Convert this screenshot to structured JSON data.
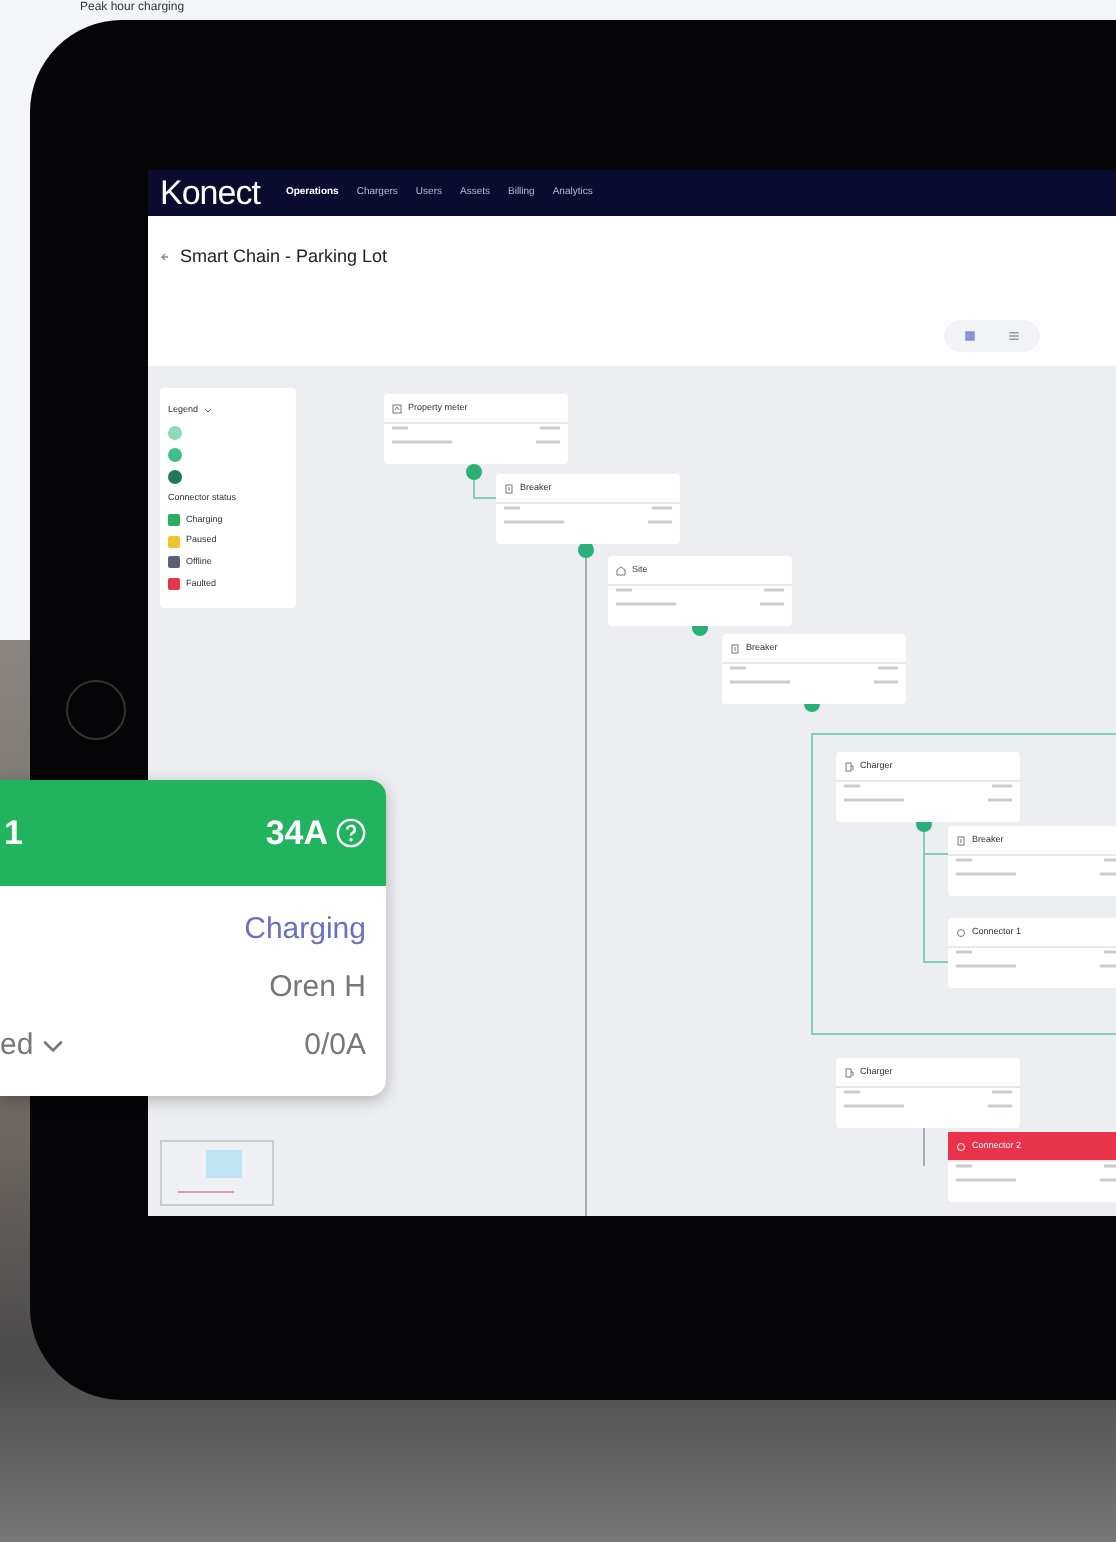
{
  "caption": "Peak hour charging",
  "app": {
    "logo": "Konect",
    "nav": [
      {
        "label": "Operations",
        "selected": true
      },
      {
        "label": "Chargers",
        "selected": false
      },
      {
        "label": "Users",
        "selected": false
      },
      {
        "label": "Assets",
        "selected": false
      },
      {
        "label": "Billing",
        "selected": false
      },
      {
        "label": "Analytics",
        "selected": false
      }
    ],
    "title": "Smart Chain - Parking Lot",
    "legend": {
      "title": "Legend",
      "status_heading": "Connector status",
      "statuses": [
        {
          "label": "Charging",
          "color": "#27ae60"
        },
        {
          "label": "Paused",
          "color": "#f2c230"
        },
        {
          "label": "Offline",
          "color": "#5c5f78"
        },
        {
          "label": "Faulted",
          "color": "#e8334a"
        }
      ]
    },
    "nodes": [
      {
        "title": "Property meter",
        "kind": "meter",
        "faulted": false
      },
      {
        "title": "Breaker",
        "kind": "breaker",
        "faulted": false
      },
      {
        "title": "Site",
        "kind": "site",
        "faulted": false
      },
      {
        "title": "Breaker",
        "kind": "breaker",
        "faulted": false
      },
      {
        "title": "Charger",
        "kind": "charger",
        "faulted": false
      },
      {
        "title": "Breaker",
        "kind": "breaker",
        "faulted": false
      },
      {
        "title": "Connector 1",
        "kind": "connector",
        "faulted": false
      },
      {
        "title": "Charger",
        "kind": "charger",
        "faulted": false
      },
      {
        "title": "Connector 2",
        "kind": "connector",
        "faulted": true
      }
    ]
  },
  "card": {
    "title": "1",
    "current": "34A",
    "status": "Charging",
    "user": "Oren H",
    "field": "ed",
    "reading": "0/0A"
  }
}
